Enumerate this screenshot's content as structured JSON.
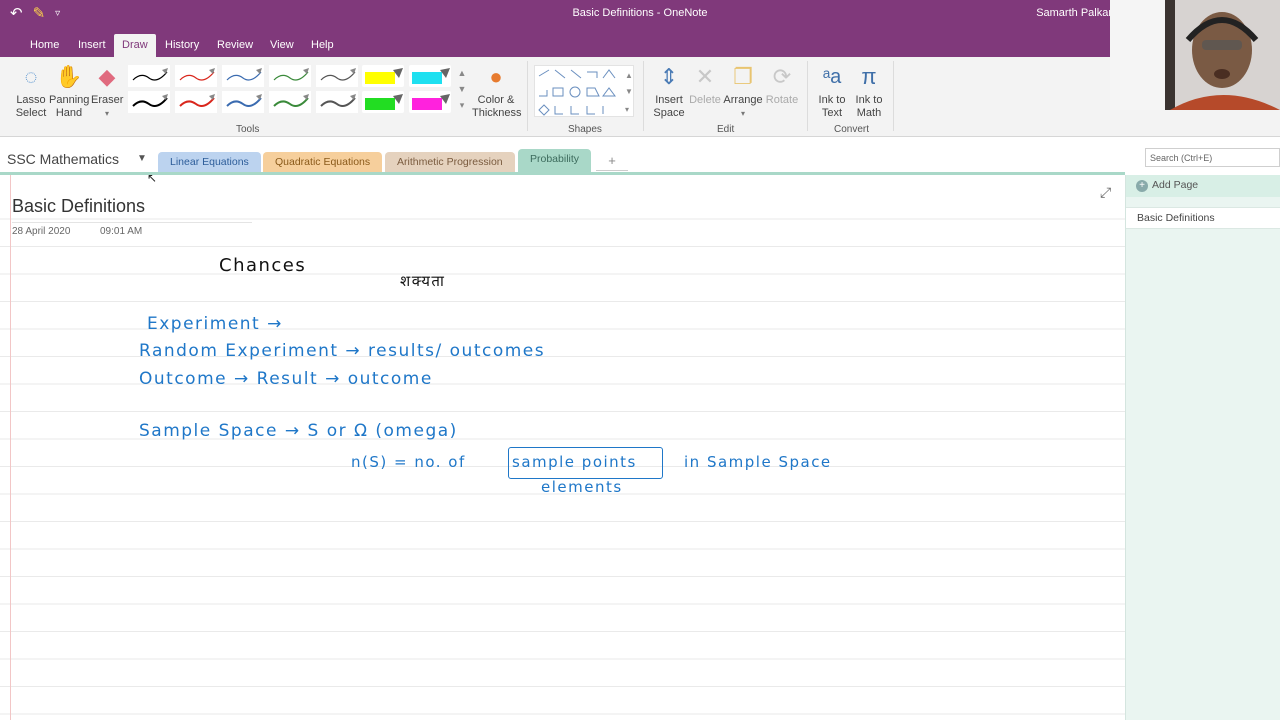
{
  "window": {
    "title": "Basic Definitions  -  OneNote",
    "user": "Samarth Palkar"
  },
  "qat": {
    "undo_glyph": "↶",
    "pen_glyph": "✎",
    "more_glyph": "▿"
  },
  "ribbon_tabs": [
    {
      "label": "Home"
    },
    {
      "label": "Insert"
    },
    {
      "label": "Draw",
      "active": true
    },
    {
      "label": "History"
    },
    {
      "label": "Review"
    },
    {
      "label": "View"
    },
    {
      "label": "Help"
    }
  ],
  "ribbon": {
    "tools": {
      "lasso": "Lasso\nSelect",
      "panning": "Panning\nHand",
      "eraser": "Eraser",
      "color_thickness": "Color &\nThickness",
      "group_label": "Tools"
    },
    "pens": [
      {
        "color": "#000000"
      },
      {
        "color": "#d9261c"
      },
      {
        "color": "#3a6bb0"
      },
      {
        "color": "#3a8a3a"
      },
      {
        "color": "#555555"
      },
      {
        "color": "#000000"
      },
      {
        "color": "#d9261c"
      },
      {
        "color": "#3a6bb0"
      },
      {
        "color": "#3a8a3a"
      },
      {
        "color": "#555555"
      }
    ],
    "highlighters": [
      {
        "color": "#ffff00"
      },
      {
        "color": "#1ee0f0"
      },
      {
        "color": "#22dd22"
      },
      {
        "color": "#ff22dd"
      }
    ],
    "shapes": {
      "group_label": "Shapes"
    },
    "edit": {
      "insert_space": "Insert\nSpace",
      "delete": "Delete",
      "arrange": "Arrange",
      "rotate": "Rotate",
      "group_label": "Edit"
    },
    "convert": {
      "ink_to_text": "Ink to\nText",
      "ink_to_math": "Ink to\nMath",
      "group_label": "Convert"
    }
  },
  "notebook": {
    "name": "SSC Mathematics",
    "sections": [
      {
        "label": "Linear Equations",
        "color": "#bcd3ef",
        "text": "#2d5d9a"
      },
      {
        "label": "Quadratic Equations",
        "color": "#f6cf9c",
        "text": "#8a5a1a"
      },
      {
        "label": "Arithmetic Progression",
        "color": "#e5d2be",
        "text": "#7a5b3f"
      },
      {
        "label": "Probability",
        "color": "#a9d8c8",
        "text": "#3d6b5d",
        "active": true
      }
    ],
    "add_section": "+"
  },
  "search": {
    "placeholder": "Search (Ctrl+E)"
  },
  "page": {
    "title": "Basic Definitions",
    "date": "28 April 2020",
    "time": "09:01 AM"
  },
  "ink": {
    "chances": "Chances",
    "hindi": "शक्यता",
    "experiment": "Experiment →",
    "random_experiment": "Random  Experiment  →   results/ outcomes",
    "outcome": "Outcome  → Result    → outcome",
    "sample_space": "Sample  Space  →       S     or  Ω (omega)",
    "ns_left": "n(S) = no. of",
    "sample_points": "sample points",
    "in_sample_space": "in   Sample  Space",
    "elements": "elements"
  },
  "pages_pane": {
    "add_page": "Add Page",
    "pages": [
      {
        "title": "Basic Definitions"
      }
    ]
  }
}
